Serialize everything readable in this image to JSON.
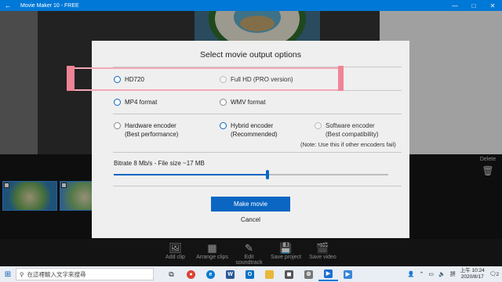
{
  "window": {
    "title": "Movie Maker 10 - FREE",
    "back_glyph": "←",
    "minimize_glyph": "—",
    "maximize_glyph": "□",
    "close_glyph": "✕"
  },
  "dialog": {
    "title": "Select movie output options",
    "resolution": [
      {
        "label": "HD720",
        "selected": true,
        "enabled": true
      },
      {
        "label": "Full HD (PRO version)",
        "selected": false,
        "enabled": false
      }
    ],
    "format": [
      {
        "label": "MP4 format",
        "selected": true,
        "enabled": true
      },
      {
        "label": "WMV format",
        "selected": false,
        "enabled": true
      }
    ],
    "encoder": [
      {
        "line1": "Hardware encoder",
        "line2": "(Best performance)",
        "selected": false,
        "enabled": true
      },
      {
        "line1": "Hybrid encoder",
        "line2": "(Recommended)",
        "selected": true,
        "enabled": true
      },
      {
        "line1": "Software encoder",
        "line2": "(Best compatibility)",
        "selected": false,
        "enabled": false
      }
    ],
    "encoder_note": "(Note: Use this if other encoders fail)",
    "bitrate_text": "Bitrate 8 Mb/s - File size ~17 MB",
    "bitrate_slider_fraction": 0.56,
    "make_label": "Make movie",
    "cancel_label": "Cancel"
  },
  "timeline": {
    "delete_label": "Delete"
  },
  "toolbar": [
    {
      "icon": "add-clip-icon",
      "glyph": "🖼",
      "label": "Add clip"
    },
    {
      "icon": "arrange-clips-icon",
      "glyph": "▦",
      "label": "Arrange clips"
    },
    {
      "icon": "edit-soundtrack-icon",
      "glyph": "✎",
      "label": "Edit soundtrack"
    },
    {
      "icon": "save-project-icon",
      "glyph": "💾",
      "label": "Save project"
    },
    {
      "icon": "save-video-icon",
      "glyph": "🎬",
      "label": "Save video"
    }
  ],
  "taskbar": {
    "search_placeholder": "在這裡輸入文字來搜尋",
    "time": "上午 10:24",
    "date": "2020/8/17",
    "notification_count": "2"
  },
  "colors": {
    "accent": "#0a66c2",
    "titlebar": "#0078d7",
    "highlight": "#f08496"
  }
}
